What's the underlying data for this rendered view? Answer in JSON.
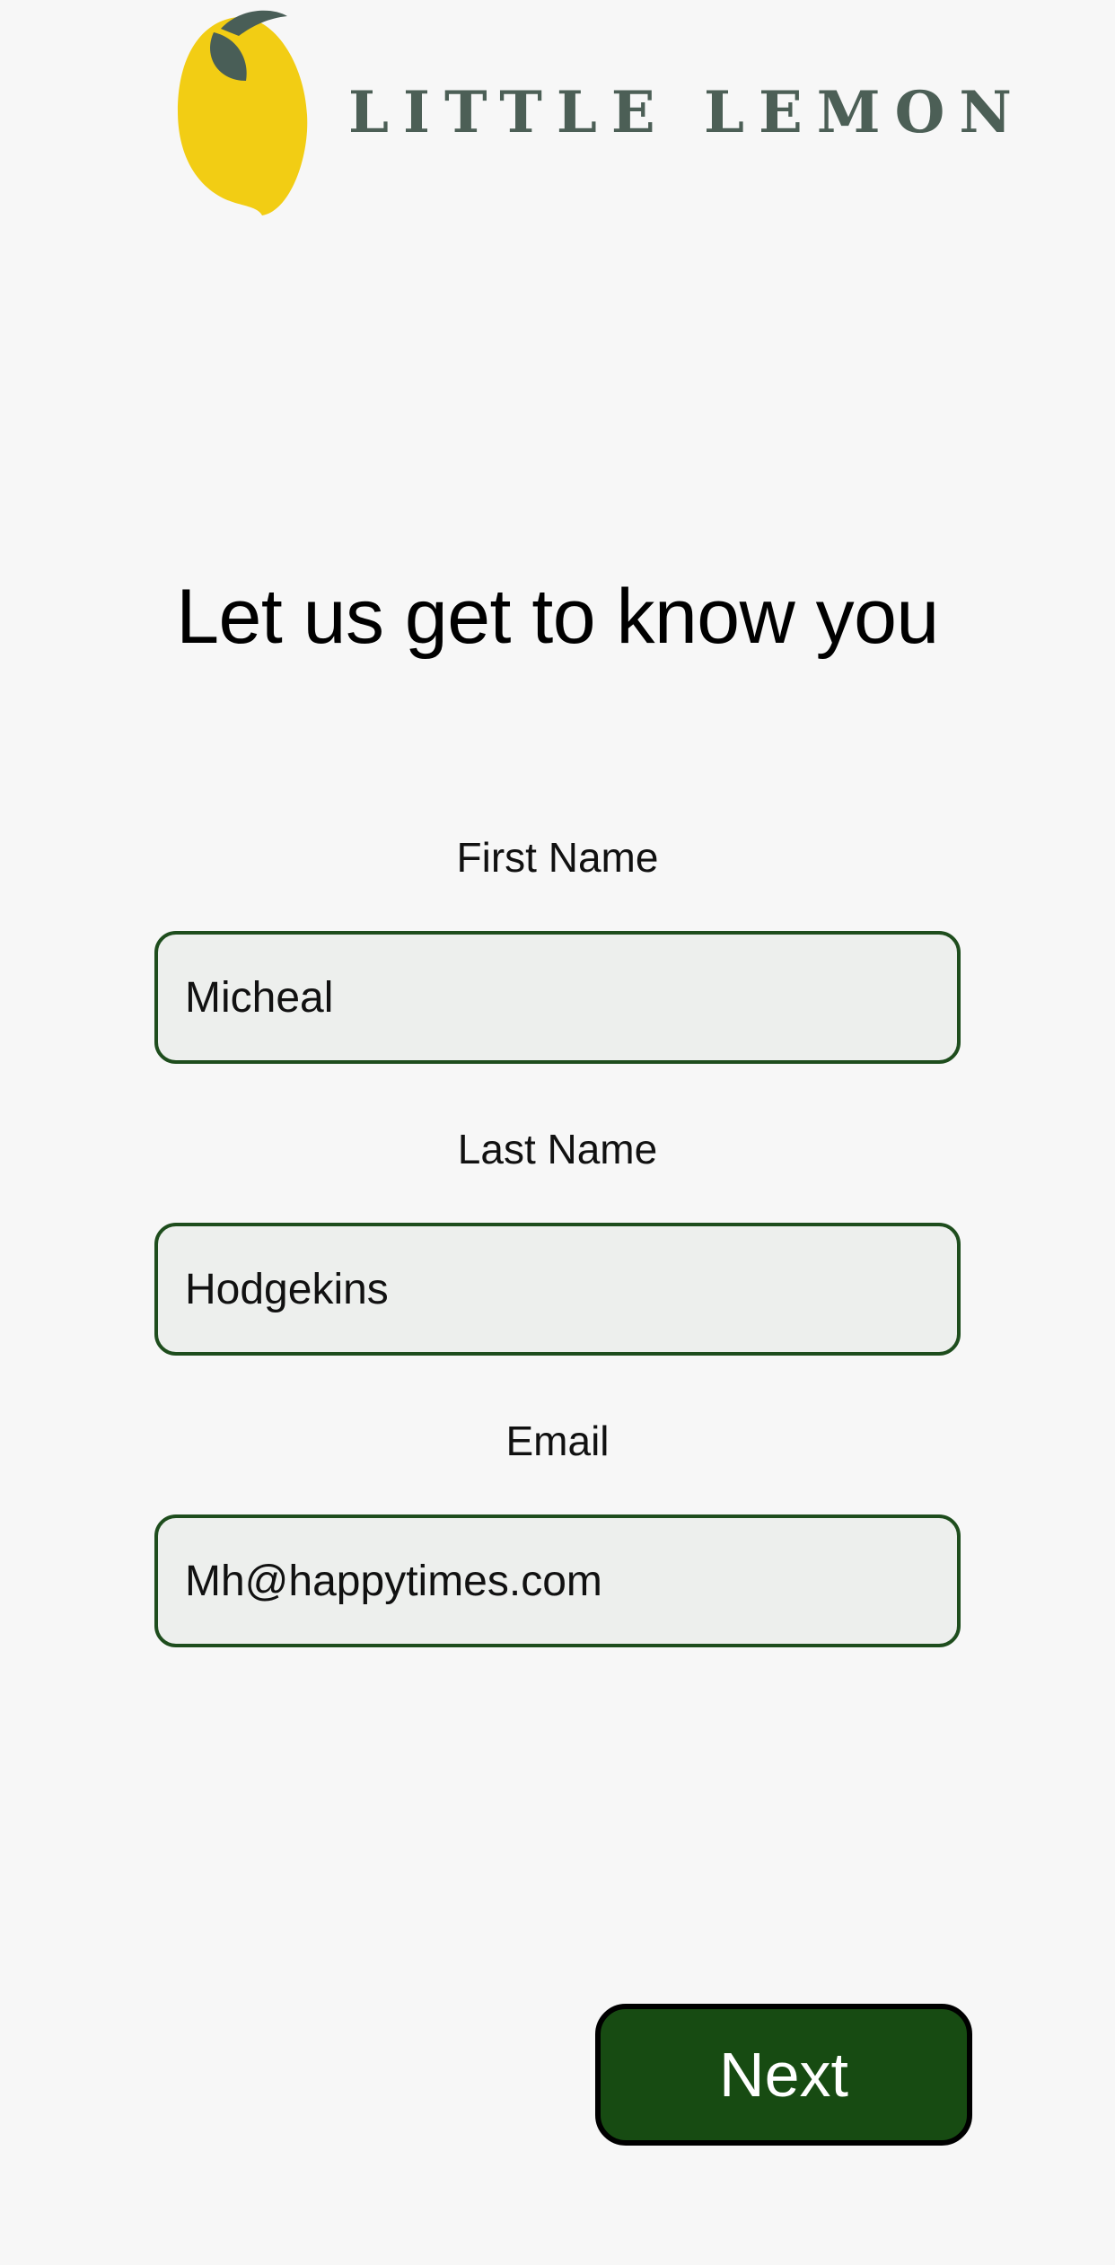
{
  "brand": {
    "name": "LITTLE LEMON",
    "logo_icon": "lemon-icon"
  },
  "heading": "Let us get to know you",
  "form": {
    "first_name": {
      "label": "First Name",
      "value": "Micheal"
    },
    "last_name": {
      "label": "Last Name",
      "value": "Hodgekins"
    },
    "email": {
      "label": "Email",
      "value": "Mh@happytimes.com"
    }
  },
  "next_button": {
    "label": "Next"
  },
  "colors": {
    "background": "#f7f7f7",
    "brand_text": "#4c5f56",
    "lemon": "#f2cd14",
    "leaf": "#495e57",
    "input_border": "#1e4d1d",
    "input_fill": "#edefed",
    "button_fill": "#174b12",
    "button_text": "#ffffff"
  }
}
